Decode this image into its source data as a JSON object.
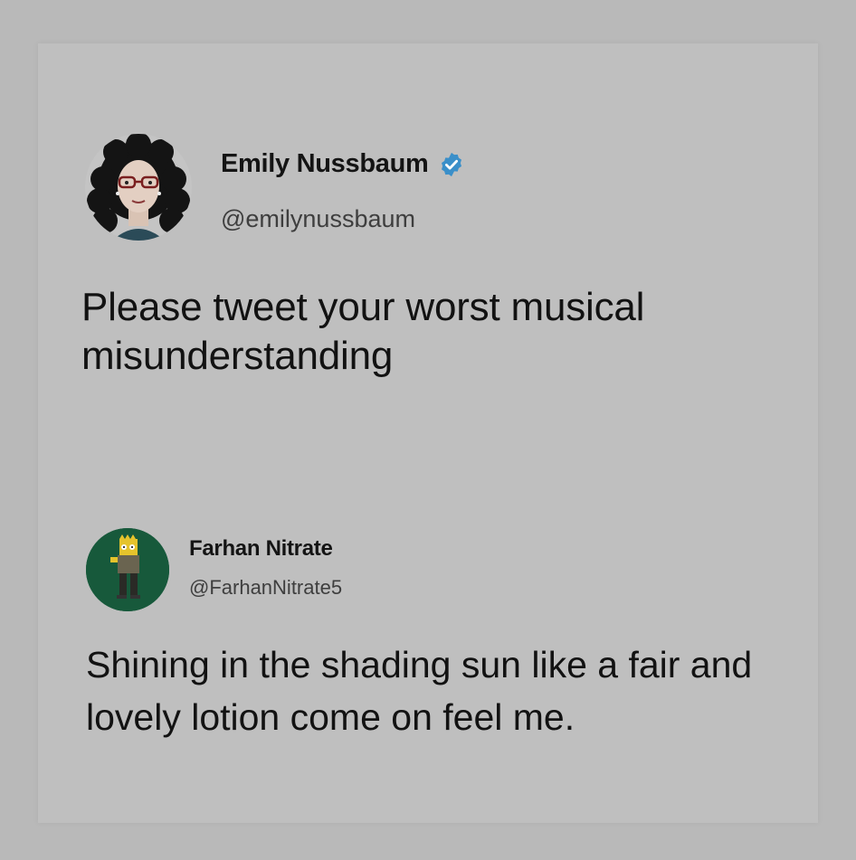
{
  "colors": {
    "background": "#b9b9b9",
    "card": "#bfbfbf",
    "verified_badge": "#3a8fc9",
    "reply_avatar_bg": "#17593b"
  },
  "main_tweet": {
    "display_name": "Emily Nussbaum",
    "verified_icon": "verified-badge-icon",
    "handle": "@emilynussbaum",
    "text": "Please tweet your worst musical misunderstanding"
  },
  "reply_tweet": {
    "display_name": "Farhan Nitrate",
    "handle": "@FarhanNitrate5",
    "text": "Shining in the shading sun like a fair and lovely lotion come on feel me."
  }
}
